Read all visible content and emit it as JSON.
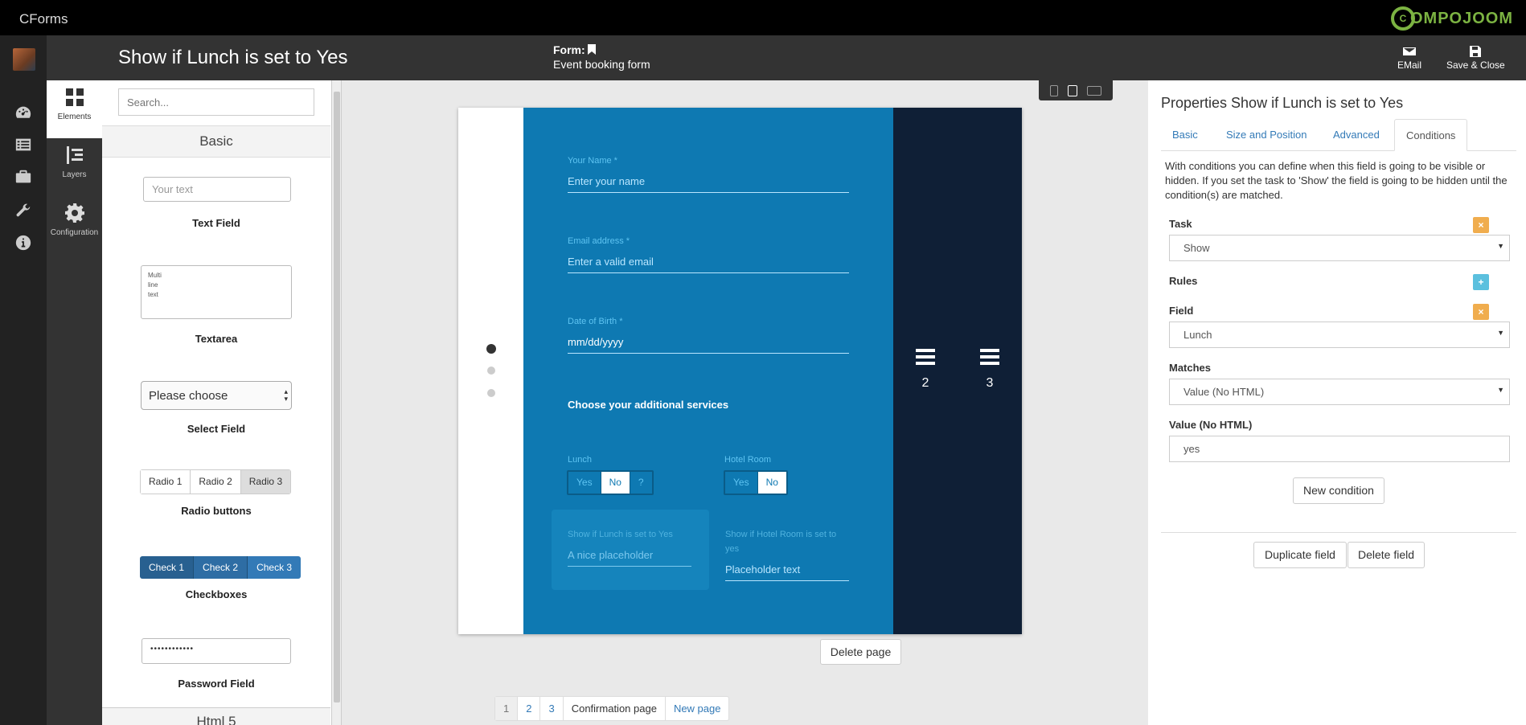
{
  "app": {
    "name": "CForms",
    "brand": "OMPOJOOM",
    "brand_initial": "C"
  },
  "header": {
    "field_title": "Show if Lunch is set to Yes",
    "form_label": "Form:",
    "form_name": "Event booking form",
    "email_label": "EMail",
    "save_close_label": "Save & Close"
  },
  "leftnav": {
    "elements": "Elements",
    "layers": "Layers",
    "configuration": "Configuration"
  },
  "elements": {
    "search_placeholder": "Search...",
    "section_basic": "Basic",
    "section_html5": "Html 5",
    "text_field": {
      "placeholder": "Your text",
      "title": "Text Field"
    },
    "textarea": {
      "line1": "Multi",
      "line2": "line",
      "line3": "text",
      "title": "Textarea"
    },
    "select_field": {
      "value": "Please choose",
      "title": "Select Field"
    },
    "radio": {
      "options": [
        "Radio 1",
        "Radio 2",
        "Radio 3"
      ],
      "title": "Radio buttons"
    },
    "checkboxes": {
      "options": [
        "Check 1",
        "Check 2",
        "Check 3"
      ],
      "title": "Checkboxes"
    },
    "password": {
      "value": "••••••••••••",
      "title": "Password Field"
    }
  },
  "preview": {
    "name_label": "Your Name *",
    "name_placeholder": "Enter your name",
    "email_label": "Email address *",
    "email_placeholder": "Enter a valid email",
    "dob_label": "Date of Birth *",
    "dob_placeholder": "mm/dd/yyyy",
    "services_heading": "Choose your additional services",
    "lunch_label": "Lunch",
    "lunch_options": [
      "Yes",
      "No",
      "?"
    ],
    "hotel_label": "Hotel Room",
    "hotel_options": [
      "Yes",
      "No"
    ],
    "cond_lunch_label": "Show if Lunch is set to Yes",
    "cond_lunch_placeholder": "A nice placeholder",
    "cond_hotel_label_1": "Show if Hotel Room is set to",
    "cond_hotel_label_2": "yes",
    "cond_hotel_placeholder": "Placeholder text",
    "page_tab_2": "2",
    "page_tab_3": "3",
    "delete_page": "Delete page"
  },
  "pager": {
    "pages": [
      "1",
      "2",
      "3"
    ],
    "confirmation": "Confirmation page",
    "new_page": "New page",
    "active_page": "1"
  },
  "properties": {
    "title": "Properties Show if Lunch is set to Yes",
    "tabs": [
      "Basic",
      "Size and Position",
      "Advanced",
      "Conditions"
    ],
    "active_tab": "Conditions",
    "description": "With conditions you can define when this field is going to be visible or hidden. If you set the task to 'Show' the field is going to be hidden until the condition(s) are matched.",
    "task_label": "Task",
    "task_value": "Show",
    "rules_label": "Rules",
    "field_label": "Field",
    "field_value": "Lunch",
    "matches_label": "Matches",
    "matches_value": "Value (No HTML)",
    "value_label": "Value (No HTML)",
    "value_value": "yes",
    "new_condition": "New condition",
    "duplicate_field": "Duplicate field",
    "delete_field": "Delete field",
    "remove_symbol": "×",
    "add_symbol": "+"
  },
  "colors": {
    "accent": "#0e79b2",
    "dark_panel": "#0f1f36",
    "brand_green": "#7cb342",
    "warning": "#f0ad4e",
    "info": "#5bc0de"
  },
  "icons": [
    "avatar",
    "dashboard-icon",
    "forms-icon",
    "briefcase-icon",
    "wrench-icon",
    "info-icon",
    "grid-icon",
    "layers-icon",
    "gear-icon",
    "envelope-icon",
    "save-icon",
    "mobile-icon",
    "tablet-icon",
    "desktop-icon",
    "menu-icon"
  ]
}
